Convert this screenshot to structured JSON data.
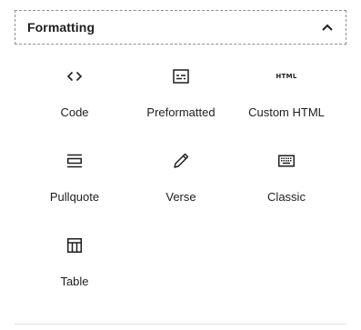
{
  "panel": {
    "title": "Formatting",
    "expanded_icon": "chevron-up-icon"
  },
  "blocks": [
    {
      "label": "Code",
      "icon": "code-icon"
    },
    {
      "label": "Preformatted",
      "icon": "preformatted-icon"
    },
    {
      "label": "Custom HTML",
      "icon": "html-icon",
      "icon_text": "HTML"
    },
    {
      "label": "Pullquote",
      "icon": "pullquote-icon"
    },
    {
      "label": "Verse",
      "icon": "pencil-icon"
    },
    {
      "label": "Classic",
      "icon": "keyboard-icon"
    },
    {
      "label": "Table",
      "icon": "table-icon"
    }
  ],
  "colors": {
    "text": "#1e1e1e",
    "border": "#8c8f94"
  }
}
